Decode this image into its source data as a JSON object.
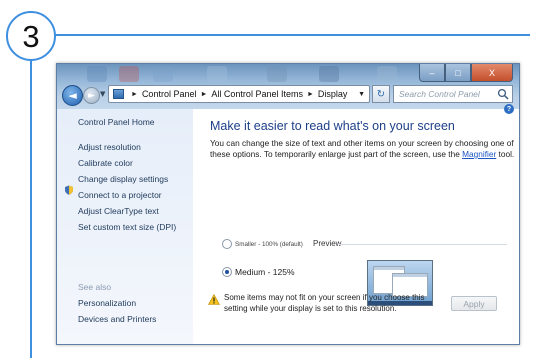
{
  "step": {
    "number": "3"
  },
  "window": {
    "caption": {
      "minimize": "–",
      "maximize": "□",
      "close": "X"
    },
    "nav": {
      "back": "◄",
      "forward": "►"
    },
    "address": {
      "crumbs": [
        "Control Panel",
        "All Control Panel Items",
        "Display"
      ],
      "separator": "►"
    },
    "search": {
      "placeholder": "Search Control Panel"
    }
  },
  "sidebar": {
    "home": "Control Panel Home",
    "items": [
      {
        "label": "Adjust resolution"
      },
      {
        "label": "Calibrate color"
      },
      {
        "label": "Change display settings"
      },
      {
        "label": "Connect to a projector"
      },
      {
        "label": "Adjust ClearType text"
      },
      {
        "label": "Set custom text size (DPI)"
      }
    ],
    "see_also_title": "See also",
    "see_also": [
      {
        "label": "Personalization"
      },
      {
        "label": "Devices and Printers"
      }
    ]
  },
  "main": {
    "heading": "Make it easier to read what's on your screen",
    "description_before_link": "You can change the size of text and other items on your screen by choosing one of these options. To temporarily enlarge just part of the screen, use the ",
    "link": "Magnifier",
    "description_after_link": " tool.",
    "options": [
      {
        "label": "Smaller - 100% (default)",
        "selected": false
      },
      {
        "label": "Medium - 125%",
        "selected": true
      }
    ],
    "preview_label": "Preview",
    "warning": "Some items may not fit on your screen if you choose this setting while your display is set to this resolution.",
    "apply": "Apply"
  },
  "colors": {
    "accent": "#3f8fe0",
    "heading": "#1e3f8a",
    "link": "#1a55c4",
    "sidebar_text": "#1e395b"
  }
}
